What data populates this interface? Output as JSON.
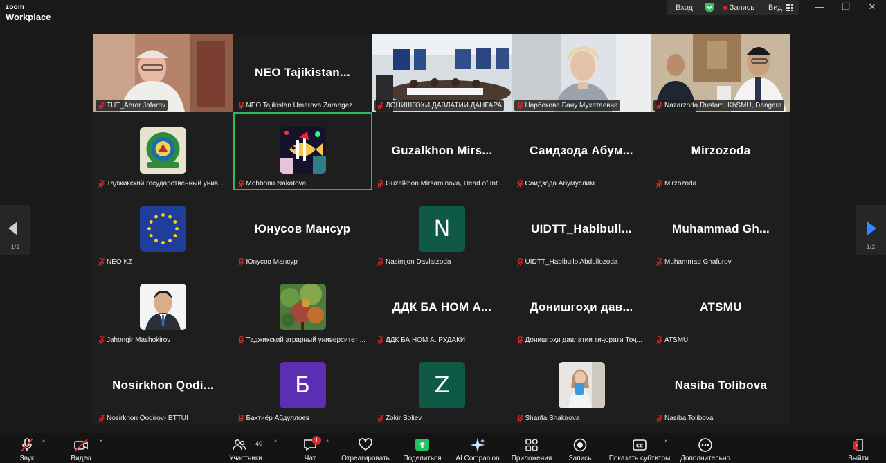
{
  "app": {
    "brand_top": "zoom",
    "brand_bottom": "Workplace"
  },
  "topbar": {
    "enter": "Вход",
    "record": "Запись",
    "view": "Вид"
  },
  "pagination": {
    "left": "1/2",
    "right": "1/2"
  },
  "tiles": [
    {
      "kind": "video",
      "tag": "TUT_Ahror Jafarov",
      "scene": "man-office"
    },
    {
      "kind": "name",
      "big": "NEO Tajikistan...",
      "tag": "NEO Tajikistan Umarova Zarangez"
    },
    {
      "kind": "video",
      "tag": "ДОНИШГОХИ ДАВЛАТИИ ДАНҒАРА",
      "scene": "meeting-room"
    },
    {
      "kind": "video",
      "tag": "Нарбекова Бану Мухатаевна",
      "scene": "woman-office"
    },
    {
      "kind": "video",
      "tag": "Nazarzoda Rustam, KhSMU, Dangara",
      "scene": "two-men"
    },
    {
      "kind": "image",
      "tag": "Таджикский государственный унив...",
      "image": "university-emblem"
    },
    {
      "kind": "image",
      "tag": "Mohbonu Nakatova",
      "image": "fish-illustration",
      "active": true
    },
    {
      "kind": "name",
      "big": "Guzalkhon  Mirs...",
      "tag": "Guzalkhon Mirsaminova, Head of Int..."
    },
    {
      "kind": "name",
      "big": "Саидзода  Абум...",
      "tag": "Саидзода Абумуслим"
    },
    {
      "kind": "name",
      "big": "Mirzozoda",
      "tag": "Mirzozoda"
    },
    {
      "kind": "image",
      "tag": "NEO KZ",
      "image": "eu-flag"
    },
    {
      "kind": "name",
      "big": "Юнусов Мансур",
      "tag": "Юнусов Мансур"
    },
    {
      "kind": "letter",
      "letter": "N",
      "color": "#0e5a47",
      "tag": "Nasimjon Davlatzoda"
    },
    {
      "kind": "name",
      "big": "UIDTT_Habibull...",
      "tag": "UIDTT_Habibullo Abdullozoda"
    },
    {
      "kind": "name",
      "big": "Muhammad  Gh...",
      "tag": "Muhammad Ghafurov"
    },
    {
      "kind": "image",
      "tag": "Jahongir Mashokirov",
      "image": "man-portrait"
    },
    {
      "kind": "image",
      "tag": "Таджикский аграрный университет ...",
      "image": "autumn-tree"
    },
    {
      "kind": "name",
      "big": "ДДК БА НОМ А...",
      "tag": "ДДК БА НОМ А. РУДАКИ"
    },
    {
      "kind": "name",
      "big": "Донишгоҳи  дав...",
      "tag": "Донишгоҳи давлатии тиҷорати Тоҷ..."
    },
    {
      "kind": "name",
      "big": "ATSMU",
      "tag": "ATSMU"
    },
    {
      "kind": "name",
      "big": "Nosirkhon  Qodi...",
      "tag": "Nosirkhon Qodirov- BTTUI"
    },
    {
      "kind": "letter",
      "letter": "Б",
      "color": "#5b2fb3",
      "tag": "Бахтиёр Абдуллоев"
    },
    {
      "kind": "letter",
      "letter": "Z",
      "color": "#0e5a47",
      "tag": "Zokir Soliev"
    },
    {
      "kind": "image",
      "tag": "Sharifa Shakirova",
      "image": "woman-selfie"
    },
    {
      "kind": "name",
      "big": "Nasiba Tolibova",
      "tag": "Nasiba Tolibova"
    }
  ],
  "toolbar": {
    "audio": "Звук",
    "video": "Видео",
    "participants": "Участники",
    "participants_count": "40",
    "chat": "Чат",
    "chat_badge": "1",
    "react": "Отреагировать",
    "share": "Поделиться",
    "ai": "AI Companion",
    "apps": "Приложения",
    "record": "Запись",
    "captions": "Показать субтитры",
    "more": "Дополнительно",
    "leave": "Выйти"
  },
  "colors": {
    "accent_green": "#2fb95a",
    "share_green": "#23c45e",
    "nav_blue": "#2d8cff",
    "danger": "#e02828"
  }
}
